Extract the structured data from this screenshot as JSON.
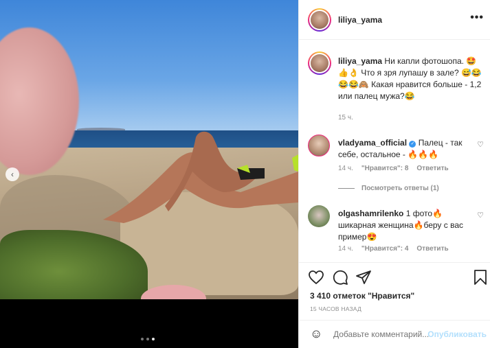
{
  "post": {
    "username": "liliya_yama",
    "more_label": "•••"
  },
  "caption": {
    "username": "liliya_yama",
    "text": "Ни капли фотошопа. 🤩👍👌 Что я зря лупашу в зале? 😅😂😂😂🙈 Какая нравится больше - 1,2 или палец мужа?😂",
    "time": "15 ч."
  },
  "comments": [
    {
      "username": "vladyama_official",
      "verified": true,
      "text": "Палец - так себе, остальное - 🔥🔥🔥",
      "time": "14 ч.",
      "likes": "\"Нравится\": 8",
      "reply": "Ответить",
      "view_replies": "Посмотреть ответы (1)"
    },
    {
      "username": "olgashamrilenko",
      "verified": false,
      "text": "1 фото🔥 шикарная женщина🔥беру с вас пример😍",
      "time": "14 ч.",
      "likes": "\"Нравится\": 4",
      "reply": "Ответить"
    }
  ],
  "stats": {
    "likes": "3 410 отметок \"Нравится\"",
    "ago": "15 ЧАСОВ НАЗАД"
  },
  "comment_box": {
    "placeholder": "Добавьте комментарий...",
    "publish": "Опубликовать",
    "emoji": "☺"
  },
  "carousel": {
    "prev": "‹",
    "total_slides": 3,
    "active_slide": 3
  },
  "icons": [
    "heart-icon",
    "comment-icon",
    "share-icon",
    "bookmark-icon",
    "emoji-icon",
    "verified-icon",
    "more-icon"
  ]
}
